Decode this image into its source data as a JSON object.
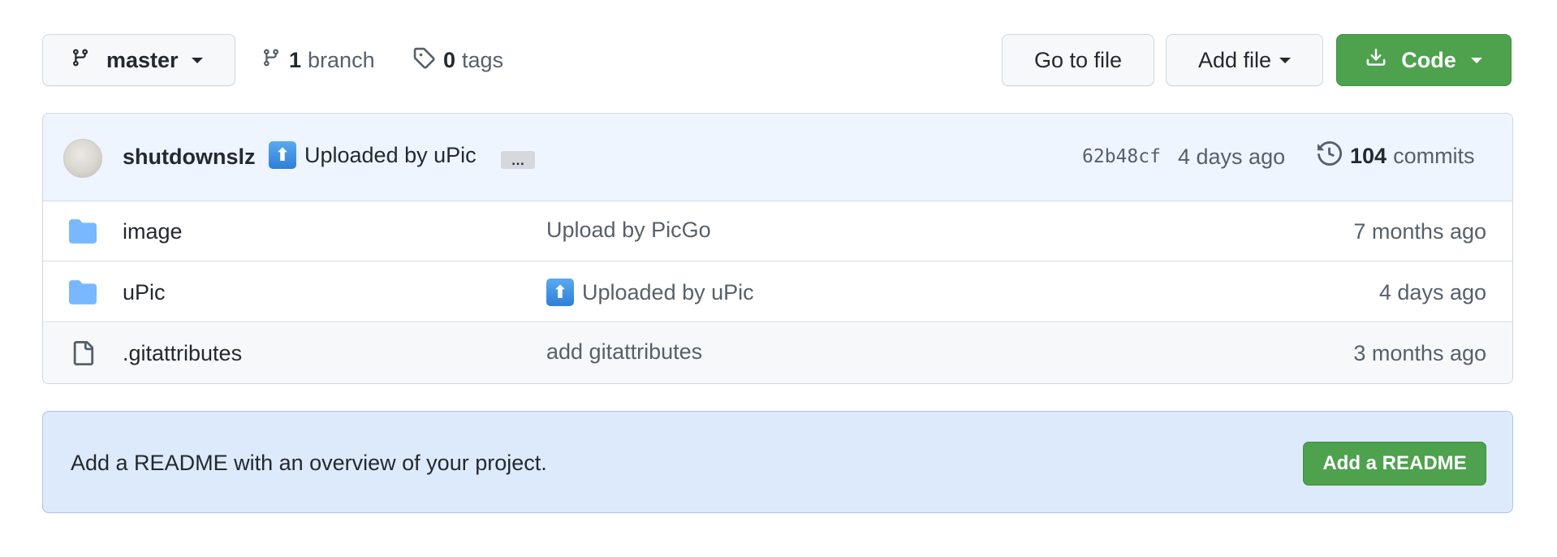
{
  "toolbar": {
    "branch_label": "master",
    "branch_count": "1",
    "branch_word": "branch",
    "tags_count": "0",
    "tags_word": "tags",
    "goto_file_label": "Go to file",
    "add_file_label": "Add file",
    "code_label": "Code"
  },
  "latest_commit": {
    "author": "shutdownslz",
    "emoji": "⬆",
    "message": "Uploaded by uPic",
    "ellipsis": "…",
    "sha": "62b48cf",
    "age": "4 days ago",
    "commit_count": "104",
    "commit_word": "commits"
  },
  "files": [
    {
      "name": "image",
      "type": "folder",
      "message": "Upload by PicGo",
      "emoji": "",
      "age": "7 months ago"
    },
    {
      "name": "uPic",
      "type": "folder",
      "message": "Uploaded by uPic",
      "emoji": "⬆",
      "age": "4 days ago"
    },
    {
      "name": ".gitattributes",
      "type": "file",
      "message": "add gitattributes",
      "emoji": "",
      "age": "3 months ago"
    }
  ],
  "readme": {
    "prompt": "Add a README with an overview of your project.",
    "button_label": "Add a README"
  },
  "colors": {
    "primary_green": "#4ea24e",
    "folder_blue": "#79b8ff",
    "commit_bar_bg": "#eef5fe",
    "readme_bg": "#ddeafc"
  }
}
